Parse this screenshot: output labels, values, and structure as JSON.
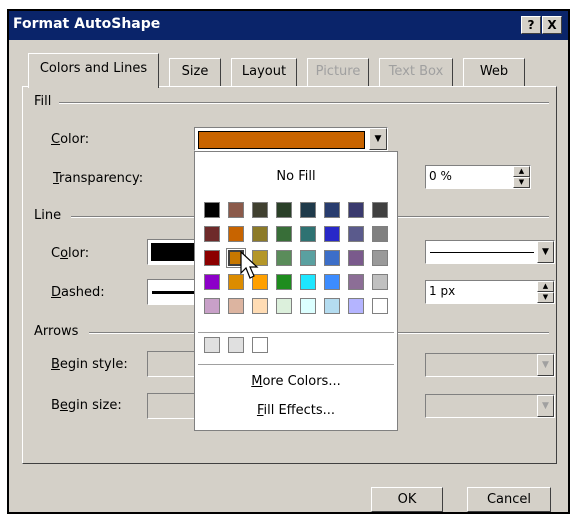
{
  "dialog": {
    "title": "Format AutoShape",
    "help_button": "?",
    "close_button": "X",
    "tabs": [
      {
        "label": "Colors and Lines",
        "active": true,
        "enabled": true
      },
      {
        "label": "Size",
        "active": false,
        "enabled": true
      },
      {
        "label": "Layout",
        "active": false,
        "enabled": true
      },
      {
        "label": "Picture",
        "active": false,
        "enabled": false
      },
      {
        "label": "Text Box",
        "active": false,
        "enabled": false
      },
      {
        "label": "Web",
        "active": false,
        "enabled": true
      }
    ],
    "fill": {
      "section_label": "Fill",
      "color_label": "Color:",
      "color_value": "#c86400",
      "transparency_label": "Transparency:",
      "transparency_value": "0 %"
    },
    "line": {
      "section_label": "Line",
      "color_label": "Color:",
      "color_value": "#000000",
      "dashed_label": "Dashed:",
      "weight_value": "1 px"
    },
    "arrows": {
      "section_label": "Arrows",
      "begin_style_label": "Begin style:",
      "begin_size_label": "Begin size:"
    },
    "ok_label": "OK",
    "cancel_label": "Cancel"
  },
  "color_popup": {
    "no_fill_label": "No Fill",
    "more_colors_label": "More Colors...",
    "fill_effects_label": "Fill Effects...",
    "selected_color": "#c87800",
    "palette": [
      [
        "#000000",
        "#8b5a4a",
        "#404030",
        "#2a4028",
        "#1f3a4a",
        "#283c6e",
        "#3a3a6e",
        "#404040"
      ],
      [
        "#6e2a2a",
        "#c86400",
        "#8c7a28",
        "#386e38",
        "#2e7272",
        "#2828c8",
        "#5a5a8c",
        "#808080"
      ],
      [
        "#8c0000",
        "#c87800",
        "#b49628",
        "#5a8c5a",
        "#5aa0a0",
        "#3c6ec8",
        "#7a5a8c",
        "#9a9a9a"
      ],
      [
        "#8c00c8",
        "#dc8c00",
        "#ffa000",
        "#1e8c1e",
        "#1ee6ff",
        "#3c8cff",
        "#8c6e96",
        "#c0c0c0"
      ],
      [
        "#c8a0c8",
        "#dcb4a0",
        "#ffdcb4",
        "#dcf0dc",
        "#dcffff",
        "#b4dcf0",
        "#b4b4ff",
        "#ffffff"
      ]
    ],
    "recent": [
      "#e0e0e0",
      "#e0e0e0",
      "#ffffff"
    ]
  }
}
